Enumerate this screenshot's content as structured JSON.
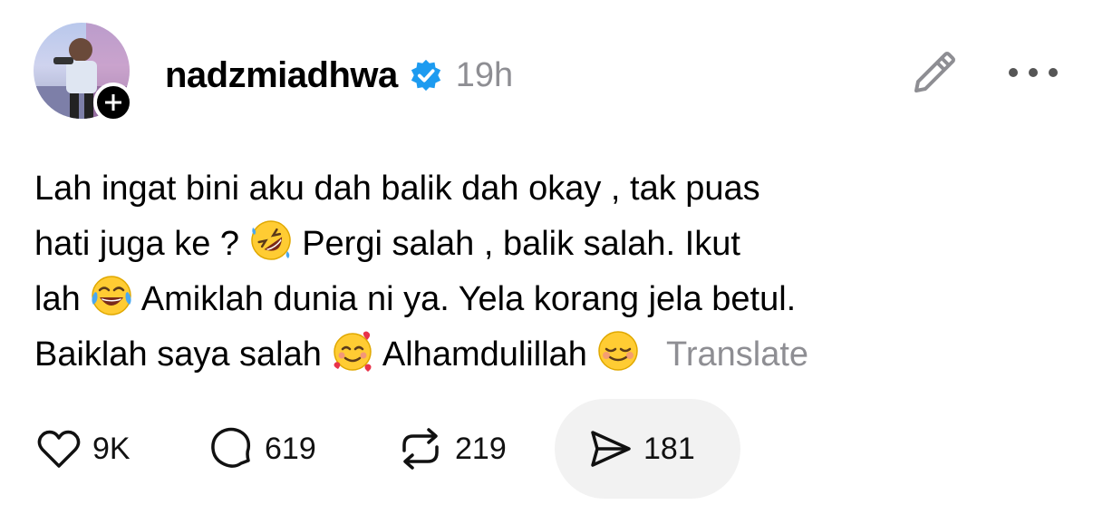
{
  "post": {
    "username": "nadzmiadhwa",
    "time": "19h",
    "verified": true,
    "text_lines": {
      "l1": "Lah ingat bini aku dah balik dah okay , tak puas",
      "l2a": "hati juga ke ?",
      "l2b": "Pergi salah , balik salah. Ikut",
      "l3a": "lah",
      "l3b": "Amiklah dunia ni ya. Yela korang jela betul.",
      "l4a": "Baiklah saya salah",
      "l4b": "Alhamdulillah"
    },
    "translate_label": "Translate",
    "emojis": [
      "rofl-emoji",
      "tears-of-joy-emoji",
      "smiling-face-with-hearts-emoji",
      "relieved-smile-emoji"
    ]
  },
  "actions": {
    "likes": "9K",
    "comments": "619",
    "reposts": "219",
    "shares": "181"
  },
  "colors": {
    "verified": "#1d9bf0",
    "muted": "#8e8e93",
    "pill_bg": "#f2f2f2"
  }
}
